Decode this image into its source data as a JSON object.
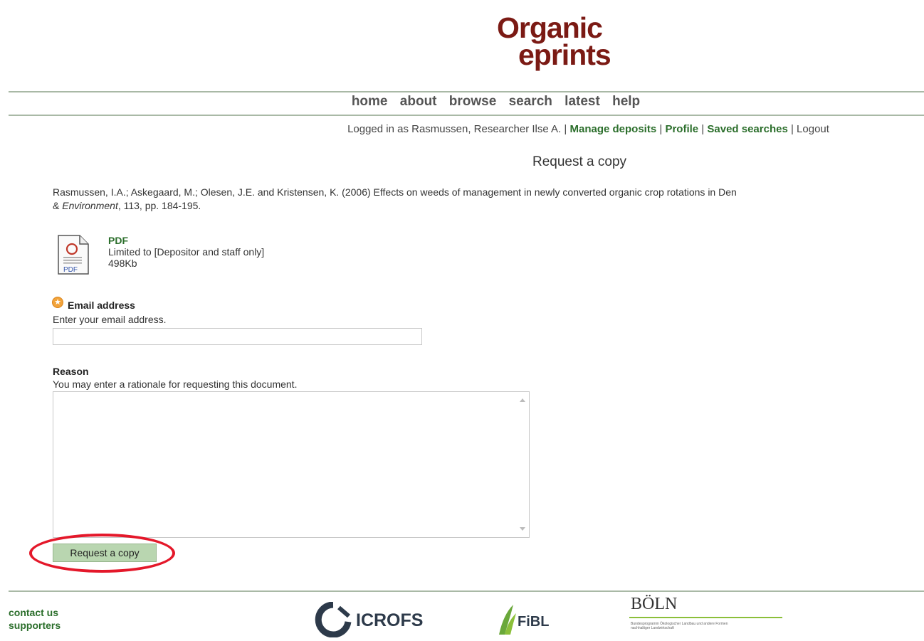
{
  "brand": {
    "logo_line1": "Organic",
    "logo_line2": "eprints"
  },
  "nav": {
    "items": [
      "home",
      "about",
      "browse",
      "search",
      "latest",
      "help"
    ]
  },
  "login": {
    "prefix": "Logged in as Rasmussen, Researcher Ilse A.",
    "manage_deposits": "Manage deposits",
    "profile": "Profile",
    "saved_searches": "Saved searches",
    "logout": "Logout",
    "separator": "|"
  },
  "page": {
    "title": "Request a copy"
  },
  "citation": {
    "line1": "Rasmussen, I.A.; Askegaard, M.; Olesen, J.E. and Kristensen, K. (2006) Effects on weeds of management in newly converted organic crop rotations in Den",
    "journal_prefix": "& ",
    "journal": "Environment",
    "line2_rest": ", 113, pp. 184-195."
  },
  "document": {
    "icon": "pdf-file-icon",
    "icon_label": "PDF",
    "format_link": "PDF",
    "access": "Limited to [Depositor and staff only]",
    "size": "498Kb"
  },
  "form": {
    "email_label": "Email address",
    "email_help": "Enter your email address.",
    "email_value": "",
    "required_icon": "required-star-icon",
    "reason_label": "Reason",
    "reason_help": "You may enter a rationale for requesting this document.",
    "reason_value": "",
    "submit_label": "Request a copy"
  },
  "footer": {
    "contact": "contact us",
    "supporters": "supporters",
    "logos": {
      "icrofs": "ICROFS",
      "fibl": "FiBL",
      "boln": "BÖLN",
      "boln_small": "Bundesprogramm Ökologischer Landbau und andere Formen nachhaltiger Landwirtschaft"
    }
  },
  "colors": {
    "brand_red": "#7b1a14",
    "link_green": "#2b6e2b",
    "button_green": "#b9d6b0",
    "rule": "#a9b9a6",
    "highlight_ring": "#e4182a"
  }
}
